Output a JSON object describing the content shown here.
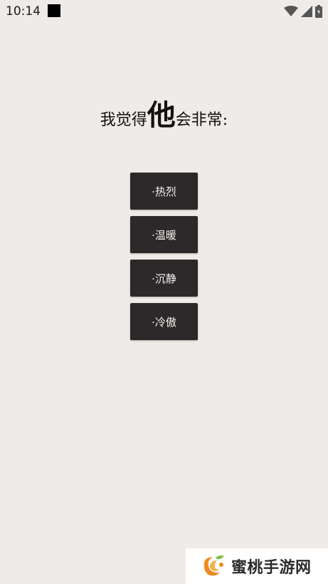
{
  "status_bar": {
    "time": "10:14",
    "icons": [
      "notification-square-icon",
      "wifi-icon",
      "signal-icon",
      "battery-icon"
    ]
  },
  "question": {
    "prefix": "我觉得",
    "emphasis": "他",
    "suffix": "会非常:"
  },
  "options": [
    {
      "label": "·热烈"
    },
    {
      "label": "·温暖"
    },
    {
      "label": "·沉静"
    },
    {
      "label": "·冷傲"
    }
  ],
  "watermark": {
    "text": "蜜桃手游网"
  },
  "colors": {
    "background": "#efebe8",
    "button": "#2b2929",
    "button_text": "#f4f1ee",
    "logo_orange": "#f08a1c",
    "logo_green": "#7cc242"
  }
}
